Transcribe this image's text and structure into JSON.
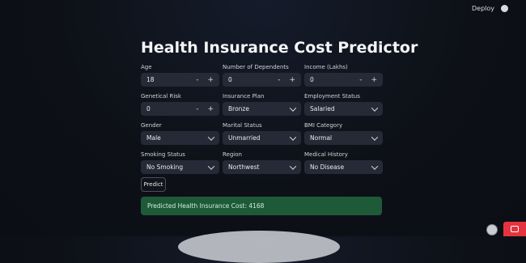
{
  "header": {
    "deploy_label": "Deploy"
  },
  "page": {
    "title": "Health Insurance Cost Predictor"
  },
  "form": {
    "age": {
      "label": "Age",
      "value": "18"
    },
    "dependents": {
      "label": "Number of Dependents",
      "value": "0"
    },
    "income": {
      "label": "Income (Lakhs)",
      "value": "0"
    },
    "genetical_risk": {
      "label": "Genetical Risk",
      "value": "0"
    },
    "insurance_plan": {
      "label": "Insurance Plan",
      "value": "Bronze"
    },
    "employment_status": {
      "label": "Employment Status",
      "value": "Salaried"
    },
    "gender": {
      "label": "Gender",
      "value": "Male"
    },
    "marital_status": {
      "label": "Marital Status",
      "value": "Unmarried"
    },
    "bmi_category": {
      "label": "BMI Category",
      "value": "Normal"
    },
    "smoking_status": {
      "label": "Smoking Status",
      "value": "No Smoking"
    },
    "region": {
      "label": "Region",
      "value": "Northwest"
    },
    "medical_history": {
      "label": "Medical History",
      "value": "No Disease"
    }
  },
  "predict_button": {
    "label": "Predict"
  },
  "result": {
    "text": "Predicted Health Insurance Cost: 4168"
  },
  "colors": {
    "background": "#0d1117",
    "input": "#262a36",
    "success": "#1f5a38",
    "badge": "#e5343f"
  },
  "icons": {
    "github": "github-icon",
    "stepper_minus": "minus-icon",
    "stepper_plus": "plus-icon",
    "dropdown": "chevron-down-icon"
  }
}
